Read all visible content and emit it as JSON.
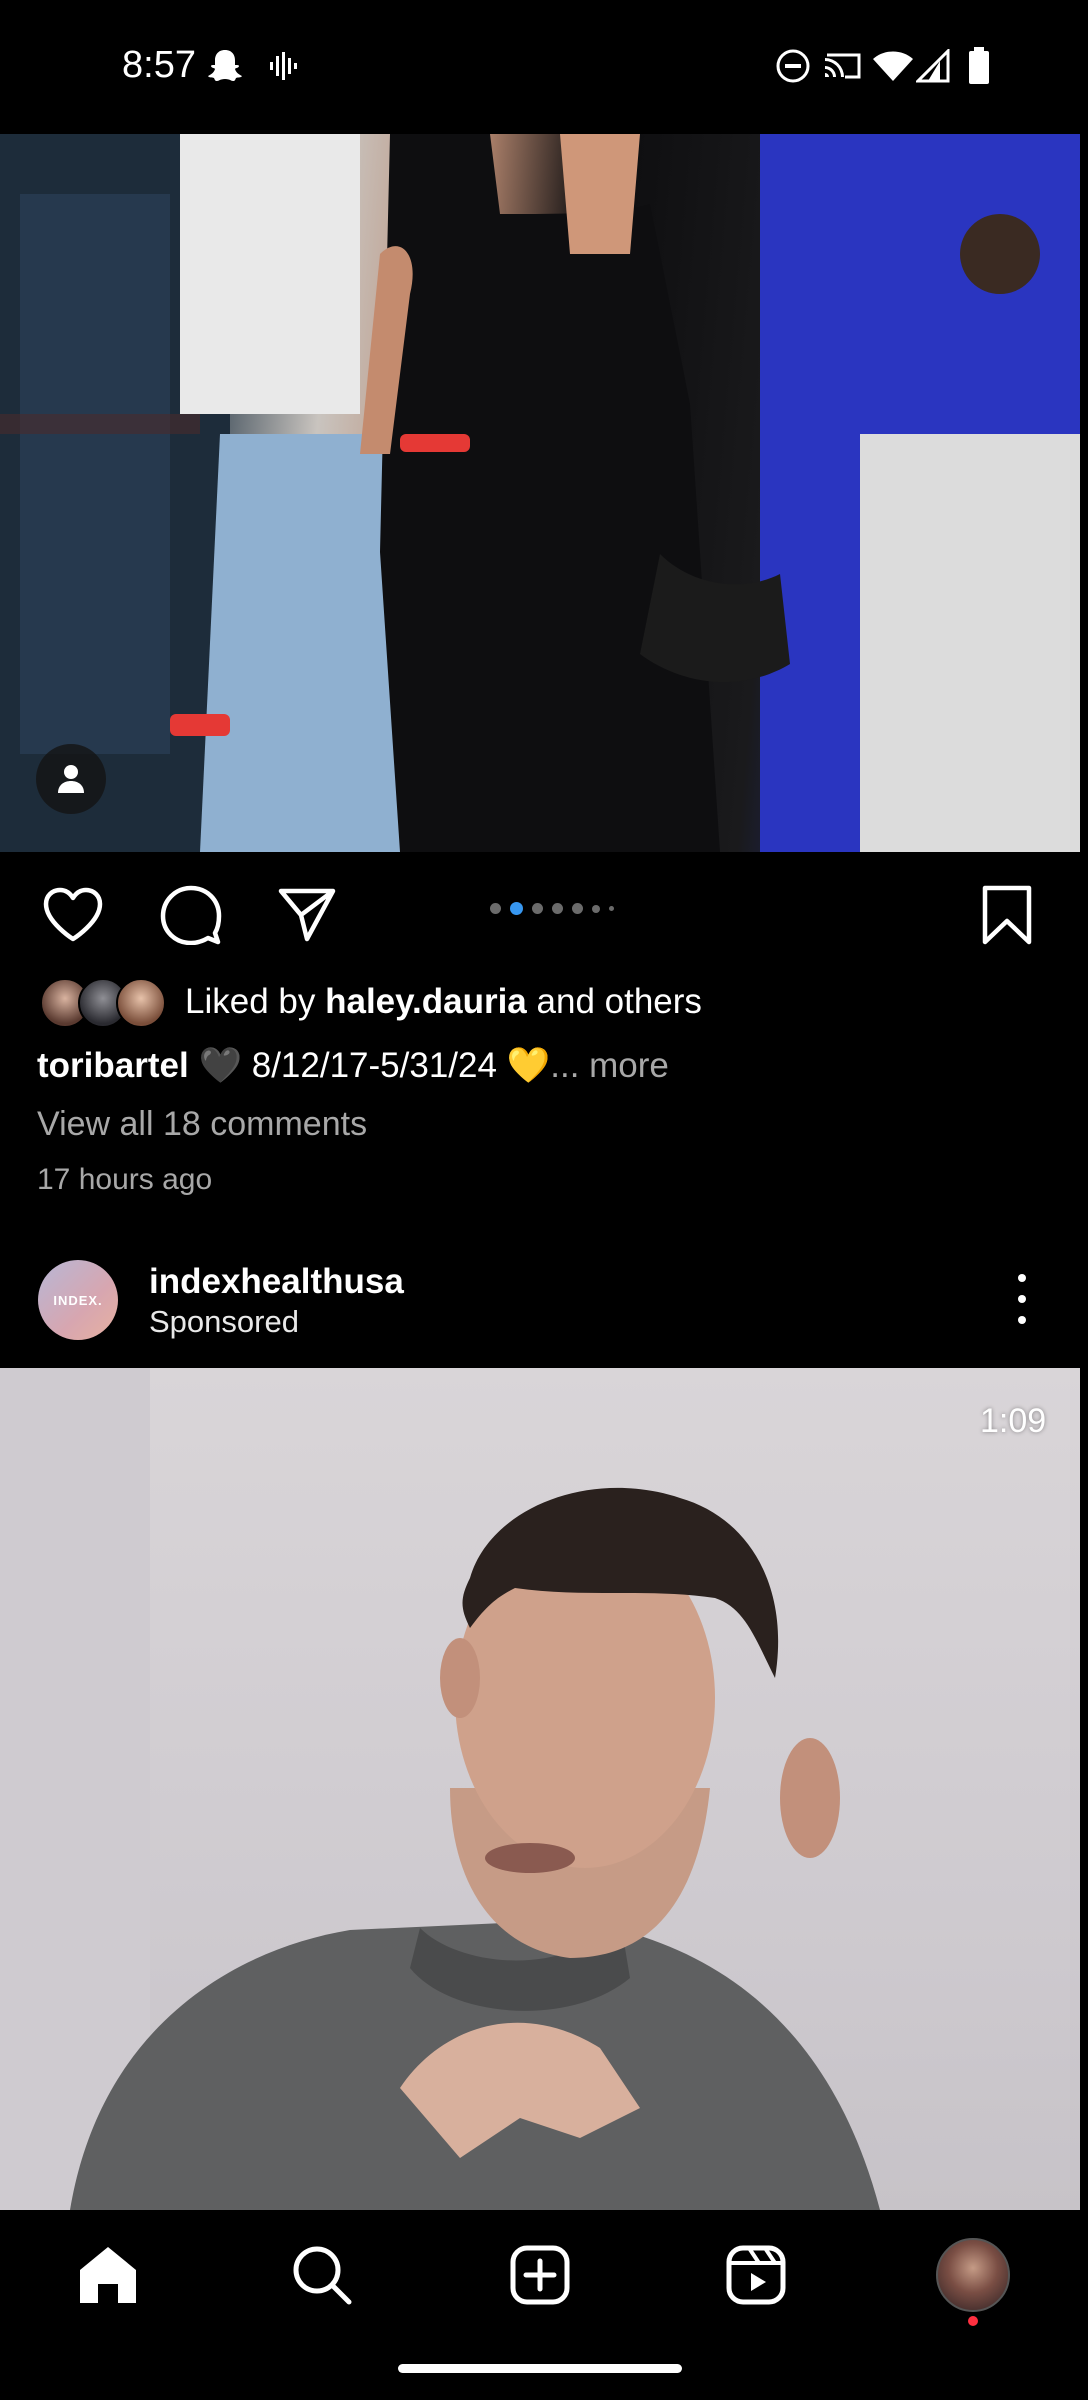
{
  "status_bar": {
    "time": "8:57",
    "left_icons": [
      "snapchat-icon",
      "voice-icon"
    ],
    "right_icons": [
      "do-not-disturb-icon",
      "cast-icon",
      "wifi-icon",
      "cellular-icon",
      "battery-icon"
    ]
  },
  "post": {
    "carousel": {
      "count": 7,
      "active_index": 1
    },
    "likes": {
      "prefix": "Liked by",
      "user": "haley.dauria",
      "suffix": "and others"
    },
    "caption": {
      "username": "toribartel",
      "text": "🖤 8/12/17-5/31/24 💛",
      "more": "... more"
    },
    "view_comments": "View all 18 comments",
    "time_ago": "17 hours ago"
  },
  "ad": {
    "username": "indexhealthusa",
    "sponsored_label": "Sponsored",
    "avatar_text": "INDEX.",
    "video_duration": "1:09"
  },
  "bottom_nav": [
    "home-icon",
    "search-icon",
    "create-icon",
    "reels-icon",
    "profile-avatar"
  ],
  "colors": {
    "background": "#000000",
    "accent": "#3797f0",
    "muted_text": "#a8a8a8",
    "notification": "#ff3040"
  }
}
